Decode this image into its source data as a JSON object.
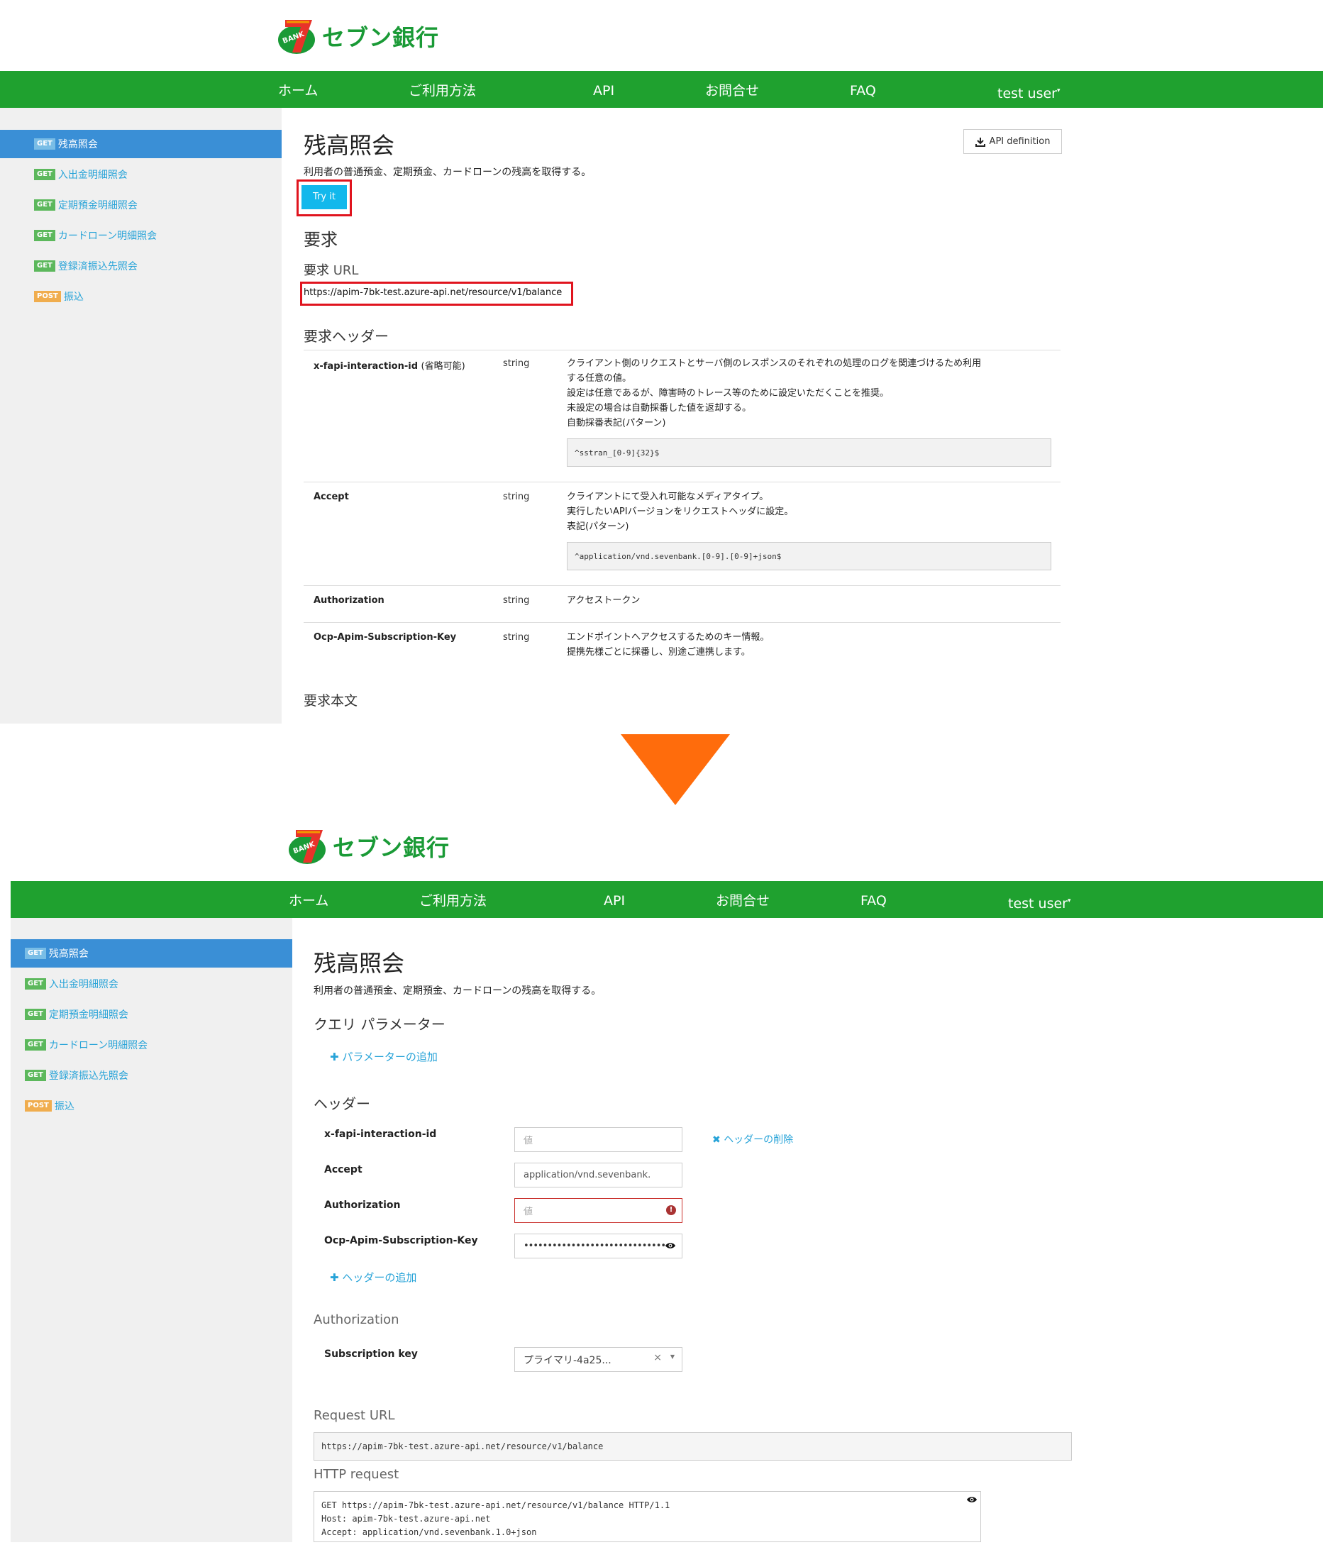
{
  "logo": {
    "text": "セブン銀行",
    "mark_text": "BANK",
    "numeral": "7"
  },
  "nav": {
    "items": [
      "ホーム",
      "ご利用方法",
      "API",
      "お問合せ",
      "FAQ",
      "test user"
    ]
  },
  "sidebar": {
    "items": [
      {
        "method": "GET",
        "label": "残高照会"
      },
      {
        "method": "GET",
        "label": "入出金明細照会"
      },
      {
        "method": "GET",
        "label": "定期預金明細照会"
      },
      {
        "method": "GET",
        "label": "カードローン明細照会"
      },
      {
        "method": "GET",
        "label": "登録済振込先照会"
      },
      {
        "method": "POST",
        "label": "振込"
      }
    ]
  },
  "top": {
    "title": "残高照会",
    "description": "利用者の普通預金、定期預金、カードローンの残高を取得する。",
    "api_definition": "API definition",
    "try_it": "Try it",
    "request_heading": "要求",
    "request_url_label": "要求",
    "request_url_label_suffix": "URL",
    "request_url": "https://apim-7bk-test.azure-api.net/resource/v1/balance",
    "headers_heading": "要求ヘッダー",
    "headers": [
      {
        "name": "x-fapi-interaction-id",
        "name_suffix": "(省略可能)",
        "type": "string",
        "desc": [
          "クライアント側のリクエストとサーバ側のレスポンスのそれぞれの処理のログを関連づけるため利用",
          "する任意の値。",
          "設定は任意であるが、障害時のトレース等のために設定いただくことを推奨。",
          "未設定の場合は自動採番した値を返却する。",
          "自動採番表記(パターン)"
        ],
        "pattern": "^sstran_[0-9]{32}$"
      },
      {
        "name": "Accept",
        "type": "string",
        "desc": [
          "クライアントにて受入れ可能なメディアタイプ。",
          "実行したいAPIバージョンをリクエストヘッダに設定。",
          "表記(パターン)"
        ],
        "pattern": "^application/vnd.sevenbank.[0-9].[0-9]+json$"
      },
      {
        "name": "Authorization",
        "type": "string",
        "desc": [
          "アクセストークン"
        ]
      },
      {
        "name": "Ocp-Apim-Subscription-Key",
        "type": "string",
        "desc": [
          "エンドポイントへアクセスするためのキー情報。",
          "提携先様ごとに採番し、別途ご連携します。"
        ]
      }
    ],
    "body_heading": "要求本文"
  },
  "bottom": {
    "title": "残高照会",
    "description": "利用者の普通預金、定期預金、カードローンの残高を取得する。",
    "query_heading": "クエリ パラメーター",
    "add_param": "パラメーターの追加",
    "headers_heading": "ヘッダー",
    "fields": [
      {
        "label": "x-fapi-interaction-id",
        "placeholder": "値",
        "value": ""
      },
      {
        "label": "Accept",
        "placeholder": "",
        "value": "application/vnd.sevenbank."
      },
      {
        "label": "Authorization",
        "placeholder": "値",
        "value": ""
      },
      {
        "label": "Ocp-Apim-Subscription-Key",
        "placeholder": "",
        "value": "••••••••••••••••••••••••••••••••"
      }
    ],
    "remove_header": "ヘッダーの削除",
    "add_header": "ヘッダーの追加",
    "auth_heading": "Authorization",
    "subscription_label": "Subscription key",
    "subscription_value": "プライマリ-4a25...",
    "request_url_heading": "Request URL",
    "request_url": "https://apim-7bk-test.azure-api.net/resource/v1/balance",
    "http_heading": "HTTP request",
    "http_lines": [
      "GET https://apim-7bk-test.azure-api.net/resource/v1/balance HTTP/1.1",
      "Host: apim-7bk-test.azure-api.net",
      "Accept: application/vnd.sevenbank.1.0+json"
    ]
  },
  "colors": {
    "nav_green": "#1fa12f",
    "link_blue": "#27a3d8",
    "active_blue": "#3a8fd6",
    "try_it": "#12b8ec",
    "highlight_red": "#e0141e",
    "arrow_orange": "#ff6c0c"
  }
}
